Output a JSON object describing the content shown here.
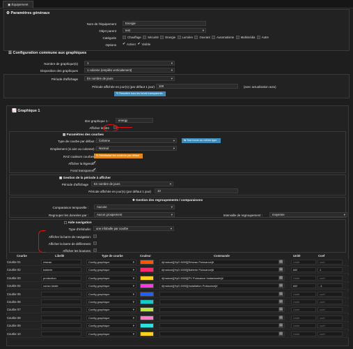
{
  "tab": {
    "label": "Équipement"
  },
  "general": {
    "title": "Paramètres généraux",
    "eq_name_label": "Nom de l'équipement",
    "eq_name_value": "Energie",
    "parent_label": "Objet parent",
    "parent_value": "test",
    "category_label": "Catégorie",
    "categories": [
      "Chauffage",
      "Sécurité",
      "Energie",
      "Lumière",
      "Ouvrant",
      "Automatisme",
      "Multimédia",
      "Autre"
    ],
    "options_label": "Options",
    "opt_active": "Activer",
    "opt_visible": "Visible"
  },
  "common": {
    "title": "Configuration commune aux graphiques",
    "nb_label": "Nombre de graphique(s)",
    "nb_value": "1",
    "disp_label": "Disposition des graphiques",
    "disp_value": "1 colonne (empilés verticalement)",
    "period_label": "Période d'affichage",
    "period_value": "En nombre de jours",
    "days_label": "Période affichée en jour(s) (par défaut 1 jour)",
    "days_value": "100",
    "auto_note": "(avec actualisation auto)",
    "reset_button": "Remettre tous les fonds transparents"
  },
  "graph": {
    "title": "Graphique 1",
    "title_label": "titre graphique 1 :",
    "title_value": "energy",
    "show_title_label": "Afficher le titre",
    "curve_params_title": "Paramètres des courbes",
    "curve_type_label": "Type de courbe par défaut :",
    "curve_type_value": "Colonne",
    "all_same_button": "Tout forcer au même type",
    "stack_label": "Empilement (si aire ou colonne) :",
    "stack_value": "Normal",
    "raz_label": "RAZ couleurs courbes :",
    "raz_button": "Réinitialise les couleurs par défaut",
    "legend_label": "Afficher la légende :",
    "bg_label": "Fond transparent :",
    "period_title": "Gestion de la période à afficher",
    "period_label": "Période d'affichage",
    "period_value": "En nombre de jours",
    "days_label": "Période affichée en jour(s) (par défaut 1 jour)",
    "days_value": "10",
    "group_title": "Gestion des regroupements / comparaisons",
    "compare_label": "Comparaison temporelle :",
    "compare_value": "Aucune",
    "group_label": "Regrouper les données par :",
    "group_value": "Aucun groupement",
    "interval_label": "Intervalle de regroupement :",
    "interval_value": "moyenne",
    "nav_title": "Aide navigation",
    "tooltip_label": "Type d'infobulle:",
    "tooltip_value": "une infobulle par courbe",
    "nav_bar_label": "Afficher la barre de navigation:",
    "scroll_bar_label": "Afficher la barre de défilement:",
    "buttons_label": "Afficher les boutons:"
  },
  "table": {
    "headers": {
      "courbe": "Courbe",
      "libelle": "Libellé",
      "type": "Type de courbe",
      "couleur": "Couleur",
      "commande": "Commande",
      "unite": "Unité",
      "coef": "Coef"
    },
    "rows": [
      {
        "name": "Courbe 01",
        "libelle": "réseau",
        "type": "Config graphique",
        "color": "#ff5500",
        "cmd": "#[maison][HyD 6000][Réseau Puissance]#",
        "unit": "Unité",
        "coef": "coef"
      },
      {
        "name": "Courbe 02",
        "libelle": "batterie",
        "type": "Config graphique",
        "color": "#ff2a6e",
        "cmd": "#[maison][HyD 6000][Batterie Puissance]#",
        "unit": "kW",
        "coef": "1"
      },
      {
        "name": "Courbe 03",
        "libelle": "production",
        "type": "Config graphique",
        "color": "#ffd21f",
        "cmd": "#[maison][HyD 6000][PV Puissance Instantanée]#",
        "unit": "Unité",
        "coef": "coef"
      },
      {
        "name": "Courbe 04",
        "libelle": "conso totale",
        "type": "Config graphique",
        "color": "#ff36e8",
        "cmd": "#[maison][HyD 6000][Installation Puissance]#",
        "unit": "kW",
        "coef": "-1"
      },
      {
        "name": "Courbe 05",
        "libelle": "",
        "type": "Config graphique",
        "color": "#2060ff",
        "cmd": "",
        "unit": "Unité",
        "coef": "coef"
      },
      {
        "name": "Courbe 06",
        "libelle": "",
        "type": "Config graphique",
        "color": "#17c9c9",
        "cmd": "",
        "unit": "Unité",
        "coef": "coef"
      },
      {
        "name": "Courbe 07",
        "libelle": "",
        "type": "Config graphique",
        "color": "#b7e63a",
        "cmd": "",
        "unit": "Unité",
        "coef": "coef"
      },
      {
        "name": "Courbe 08",
        "libelle": "",
        "type": "Config graphique",
        "color": "#ff7ac8",
        "cmd": "",
        "unit": "Unité",
        "coef": "coef"
      },
      {
        "name": "Courbe 09",
        "libelle": "",
        "type": "Config graphique",
        "color": "#2fe0e0",
        "cmd": "",
        "unit": "Unité",
        "coef": "coef"
      },
      {
        "name": "Courbe 10",
        "libelle": "",
        "type": "Config graphique",
        "color": "#ffd21f",
        "cmd": "",
        "unit": "Unité",
        "coef": "coef"
      }
    ]
  },
  "colors": {
    "accent_blue": "#3c8dbc",
    "warn_orange": "#e08a1e",
    "mark_red": "#e01010"
  }
}
